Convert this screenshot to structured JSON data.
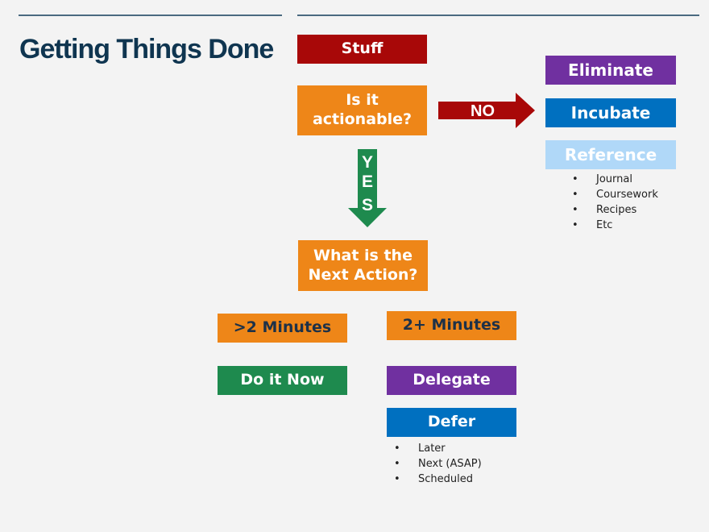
{
  "title": "Getting Things Done",
  "colors": {
    "dark_red": "#a80808",
    "orange": "#ee8618",
    "purple": "#7030a0",
    "blue": "#0070c0",
    "light_blue": "#b0d8f8",
    "green": "#1e8a4e",
    "title_navy": "#0f3550",
    "rule": "#4a6a80"
  },
  "nodes": {
    "stuff": "Stuff",
    "actionable_line1": "Is it",
    "actionable_line2": "actionable?",
    "no_arrow": "NO",
    "yes_arrow": [
      "Y",
      "E",
      "S"
    ],
    "eliminate": "Eliminate",
    "incubate": "Incubate",
    "reference": "Reference",
    "next_action_line1": "What is the",
    "next_action_line2": "Next Action?",
    "less_than_2": ">2 Minutes",
    "more_than_2": "2+ Minutes",
    "do_it_now": "Do it Now",
    "delegate": "Delegate",
    "defer": "Defer"
  },
  "reference_items": [
    "Journal",
    "Coursework",
    "Recipes",
    "Etc"
  ],
  "defer_items": [
    "Later",
    "Next (ASAP)",
    "Scheduled"
  ],
  "bullet_glyph": "•"
}
